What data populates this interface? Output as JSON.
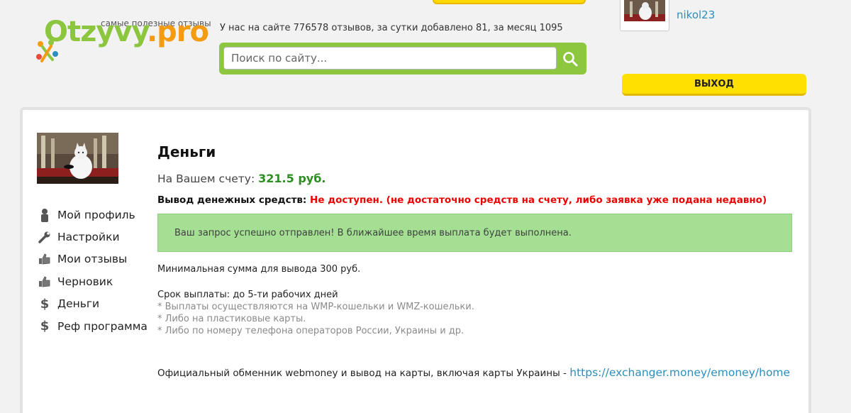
{
  "header": {
    "logo_text_part1": "Otzyvy",
    "logo_text_part2": ".pro",
    "tagline": "самые полезные отзывы",
    "stats": "У нас на сайте 776578 отзывов, за сутки добавлено 81, за месяц 1095",
    "search_placeholder": "Поиск по сайту...",
    "user_name": "nikol23",
    "logout_label": "ВЫХОД"
  },
  "sidebar": {
    "items": [
      {
        "icon": "person-icon",
        "label": "Мой профиль"
      },
      {
        "icon": "wrench-icon",
        "label": "Настройки"
      },
      {
        "icon": "thumbs-up-icon",
        "label": "Мои отзывы"
      },
      {
        "icon": "thumbs-up-icon",
        "label": "Черновик"
      },
      {
        "icon": "dollar-icon",
        "label": "Деньги"
      },
      {
        "icon": "dollar-icon",
        "label": "Реф программа"
      }
    ]
  },
  "main": {
    "title": "Деньги",
    "balance_label": "На Вашем счету:",
    "balance_value": "321.5 руб.",
    "withdraw_label": "Вывод денежных средств:",
    "withdraw_status": "Не доступен. (не достаточно средств на счету, либо заявка уже подана недавно)",
    "alert_text": "Ваш запрос успешно отправлен! В ближайшее время выплата будет выполнена.",
    "min_sum": "Минимальная сумма для вывода 300 руб.",
    "term": "Срок выплаты: до 5-ти рабочих дней",
    "notes": [
      "* Выплаты осуществляются на WMP-кошельки и WMZ-кошельки.",
      "* Либо на пластиковые карты.",
      "* Либо по номеру телефона операторов России, Украины и др."
    ],
    "exchanger_text": "Официальный обменник webmoney и вывод на карты, включая карты Украины -",
    "exchanger_link": "https://exchanger.money/emoney/home"
  },
  "colors": {
    "brand_green": "#8dc63f",
    "brand_orange": "#f39c12",
    "logout_yellow": "#ffe000",
    "balance_green": "#2a8f1f",
    "error_red": "#e00000",
    "alert_bg": "#a4df94",
    "link_blue": "#2a8fbd"
  }
}
